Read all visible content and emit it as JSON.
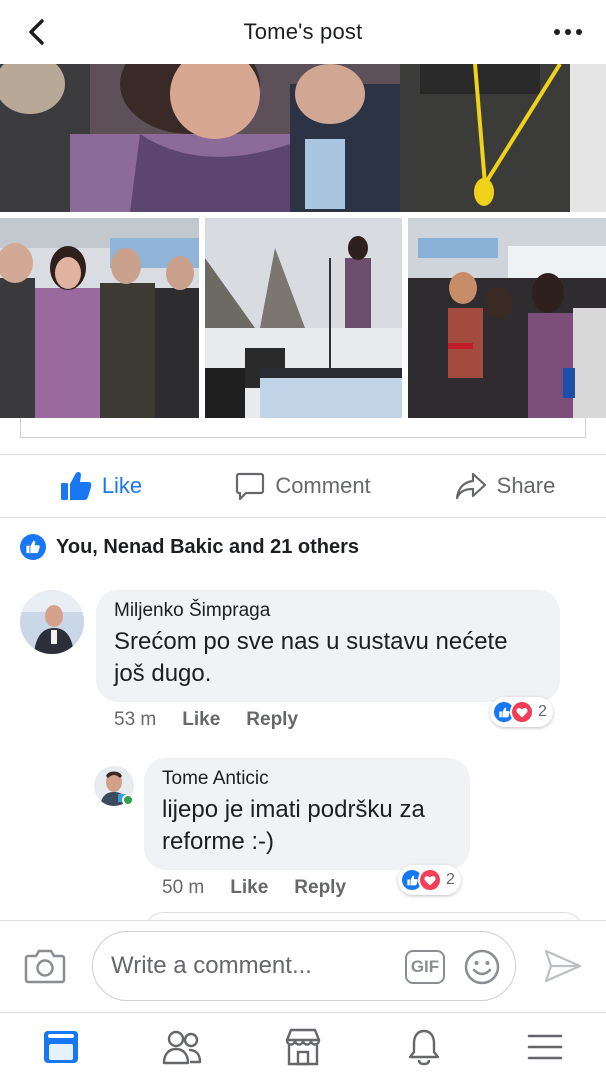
{
  "header": {
    "title": "Tome's post",
    "back_icon": "chevron-left-icon",
    "more_icon": "more-horizontal-icon"
  },
  "photos": {
    "main_alt": "Woman in purple coat smiling at rally",
    "thumb_count": 3
  },
  "actions": {
    "like_label": "Like",
    "comment_label": "Comment",
    "share_label": "Share"
  },
  "reactions": {
    "summary": "You, Nenad Bakic and 21 others"
  },
  "comments": [
    {
      "author": "Miljenko Šimpraga",
      "text": "Srećom po sve nas u sustavu nećete još dugo.",
      "time": "53 m",
      "like_label": "Like",
      "reply_label": "Reply",
      "reaction_count": "2"
    },
    {
      "author": "Tome Anticic",
      "text": "lijepo je imati podršku za reforme :-)",
      "time": "50 m",
      "like_label": "Like",
      "reply_label": "Reply",
      "reaction_count": "2"
    }
  ],
  "composer": {
    "placeholder": "Write a comment...",
    "gif_label": "GIF"
  },
  "tabs": [
    "news-feed",
    "friends",
    "marketplace",
    "notifications",
    "menu"
  ],
  "colors": {
    "accent": "#1877f2",
    "love": "#f33e58",
    "muted": "#65676b",
    "bubble": "#f0f2f5"
  }
}
